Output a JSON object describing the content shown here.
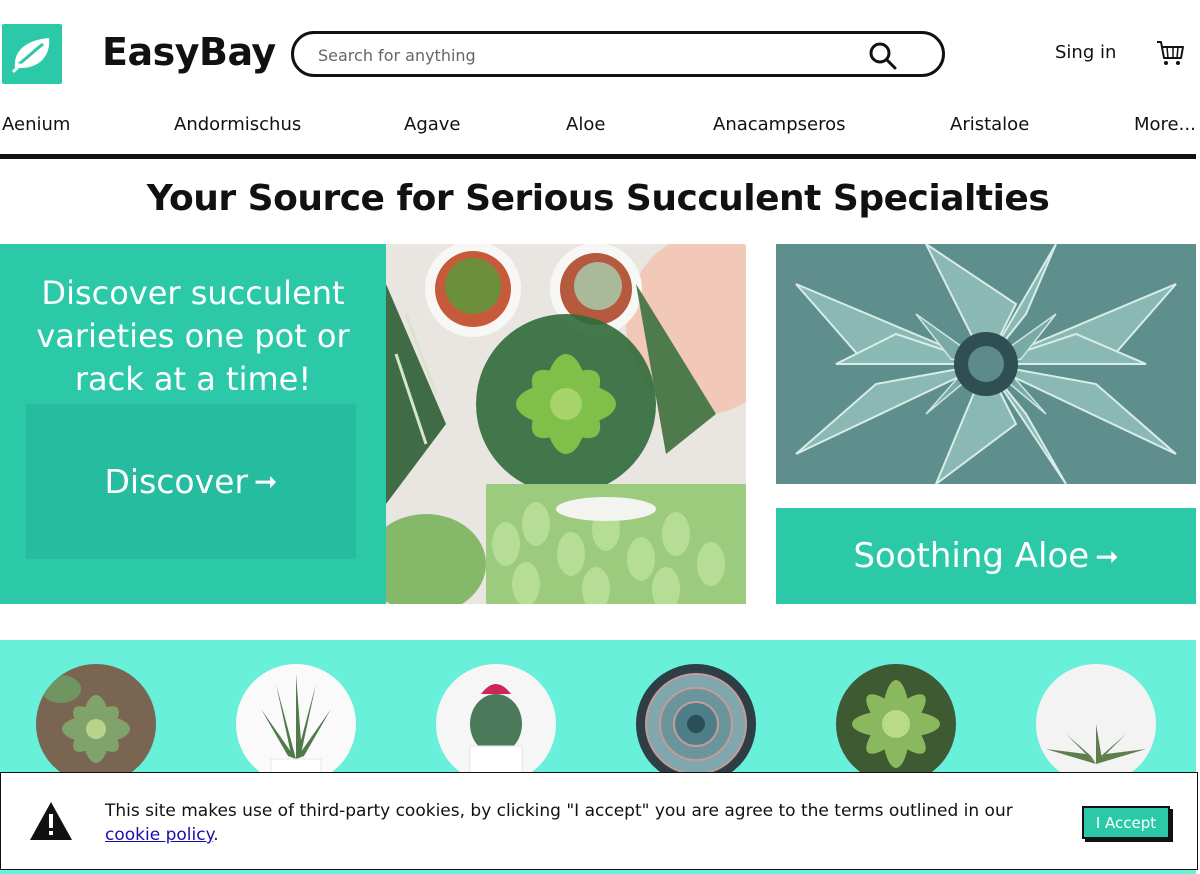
{
  "header": {
    "brand": "EasyBay",
    "search_placeholder": "Search for anything",
    "signin_label": "Sing in"
  },
  "nav": {
    "items": [
      "Aenium",
      "Andormischus",
      "Agave",
      "Aloe",
      "Anacampseros",
      "Aristaloe",
      "More..."
    ]
  },
  "headline": "Your Source for Serious Succulent Specialties",
  "hero": {
    "text": "Discover succulent varieties one pot or rack at a time!",
    "discover_label": "Discover",
    "aloe_label": "Soothing Aloe",
    "arrow": "➞"
  },
  "cookie": {
    "text": "This site makes use of third-party cookies, by clicking \"I accept\" you are agree to the terms outlined in our",
    "link_label": "cookie policy",
    "period": ".",
    "accept_label": "I Accept"
  },
  "colors": {
    "accent": "#2cc9a9",
    "strip": "#68f0da",
    "text": "#111111"
  }
}
